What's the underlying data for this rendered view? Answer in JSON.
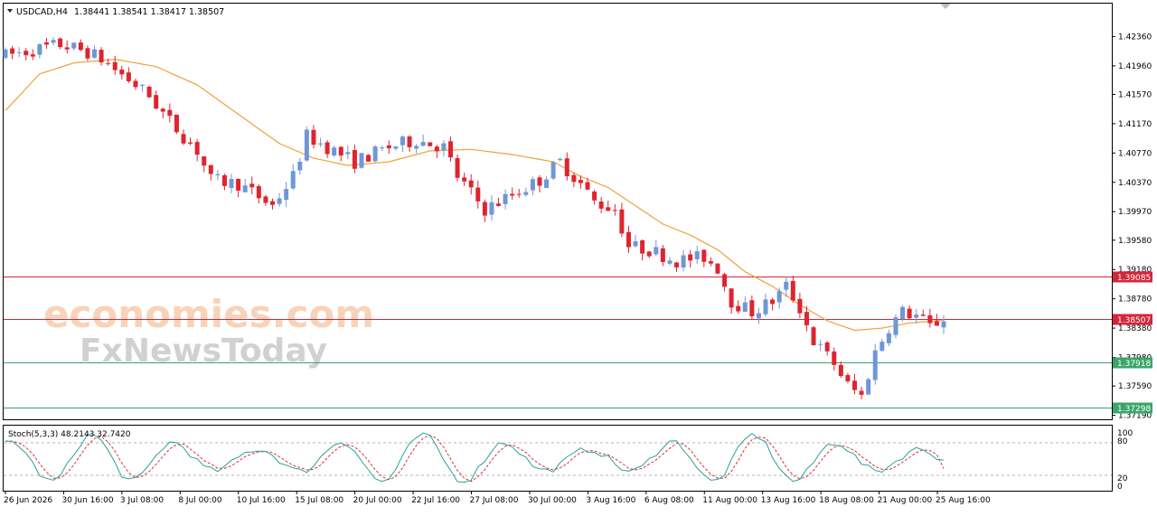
{
  "header": {
    "symbol": "USDCAD,H4",
    "ohlc": "1.38441 1.38541 1.38417 1.38507"
  },
  "watermark": {
    "line1": "economies.com",
    "line2": "FxNewsToday"
  },
  "indicator": {
    "label": "Stoch(5,3,3) 48.2143 32.7420",
    "levels": [
      "100",
      "80",
      "20",
      "0"
    ]
  },
  "colors": {
    "bull": "#6f97d6",
    "bear": "#e0242f",
    "ma": "#f0a13c",
    "resistance": "#d4263a",
    "support": "#3aa56a",
    "stoch_main": "#2aa198",
    "stoch_signal": "#e03030"
  },
  "chart_data": {
    "type": "candlestick",
    "y_ticks": [
      "1.42360",
      "1.41960",
      "1.41570",
      "1.41170",
      "1.40770",
      "1.40370",
      "1.39970",
      "1.39580",
      "1.39180",
      "1.38780",
      "1.38380",
      "1.37980",
      "1.37590",
      "1.37190"
    ],
    "ylim": [
      1.3716,
      1.4276
    ],
    "x_labels": [
      "26 Jun 2026",
      "30 Jun 16:00",
      "3 Jul 08:00",
      "8 Jul 00:00",
      "10 Jul 16:00",
      "15 Jul 08:00",
      "20 Jul 00:00",
      "22 Jul 16:00",
      "27 Jul 08:00",
      "30 Jul 00:00",
      "3 Aug 16:00",
      "6 Aug 08:00",
      "11 Aug 00:00",
      "13 Aug 16:00",
      "18 Aug 08:00",
      "21 Aug 00:00",
      "25 Aug 16:00"
    ],
    "levels": [
      {
        "label": "1.39085",
        "value": 1.39085,
        "kind": "resistance"
      },
      {
        "label": "1.38507",
        "value": 1.38507,
        "kind": "resistance"
      },
      {
        "label": "1.37918",
        "value": 1.37918,
        "kind": "support"
      },
      {
        "label": "1.37298",
        "value": 1.37298,
        "kind": "support"
      }
    ],
    "price_path": [
      [
        0,
        1.421
      ],
      [
        8,
        1.4225
      ],
      [
        12,
        1.4215
      ],
      [
        14,
        1.4205
      ],
      [
        19,
        1.417
      ],
      [
        21,
        1.4155
      ],
      [
        24,
        1.412
      ],
      [
        28,
        1.408
      ],
      [
        30,
        1.404
      ],
      [
        34,
        1.4035
      ],
      [
        39,
        1.4005
      ],
      [
        42,
        1.4045
      ],
      [
        44,
        1.41
      ],
      [
        47,
        1.4085
      ],
      [
        51,
        1.4065
      ],
      [
        56,
        1.4085
      ],
      [
        60,
        1.4095
      ],
      [
        64,
        1.4085
      ],
      [
        66,
        1.4045
      ],
      [
        70,
        1.4
      ],
      [
        74,
        1.402
      ],
      [
        78,
        1.404
      ],
      [
        81,
        1.4065
      ],
      [
        84,
        1.4035
      ],
      [
        86,
        1.401
      ],
      [
        89,
        1.4
      ],
      [
        91,
        1.395
      ],
      [
        94,
        1.3945
      ],
      [
        98,
        1.393
      ],
      [
        102,
        1.3935
      ],
      [
        104,
        1.392
      ],
      [
        106,
        1.3875
      ],
      [
        109,
        1.386
      ],
      [
        112,
        1.3875
      ],
      [
        114,
        1.3895
      ],
      [
        116,
        1.3865
      ],
      [
        118,
        1.382
      ],
      [
        121,
        1.379
      ],
      [
        123,
        1.376
      ],
      [
        125,
        1.3745
      ],
      [
        127,
        1.3805
      ],
      [
        129,
        1.384
      ],
      [
        131,
        1.386
      ],
      [
        133,
        1.3855
      ],
      [
        135,
        1.384
      ],
      [
        137,
        1.3851
      ]
    ],
    "ma_path": [
      [
        0,
        1.4135
      ],
      [
        5,
        1.4185
      ],
      [
        10,
        1.42
      ],
      [
        16,
        1.4205
      ],
      [
        22,
        1.4195
      ],
      [
        28,
        1.417
      ],
      [
        34,
        1.413
      ],
      [
        40,
        1.409
      ],
      [
        45,
        1.407
      ],
      [
        50,
        1.406
      ],
      [
        56,
        1.4065
      ],
      [
        62,
        1.408
      ],
      [
        68,
        1.4082
      ],
      [
        74,
        1.4075
      ],
      [
        80,
        1.4065
      ],
      [
        84,
        1.4045
      ],
      [
        88,
        1.403
      ],
      [
        92,
        1.4005
      ],
      [
        96,
        1.398
      ],
      [
        100,
        1.3965
      ],
      [
        104,
        1.3945
      ],
      [
        108,
        1.3915
      ],
      [
        112,
        1.3895
      ],
      [
        116,
        1.387
      ],
      [
        120,
        1.3848
      ],
      [
        124,
        1.3835
      ],
      [
        128,
        1.3838
      ],
      [
        132,
        1.3845
      ],
      [
        137,
        1.3849
      ]
    ],
    "stochastic": {
      "ylim": [
        0,
        100
      ],
      "main_last": 48.2143,
      "signal_last": 32.742,
      "levels": [
        80,
        20
      ]
    }
  }
}
